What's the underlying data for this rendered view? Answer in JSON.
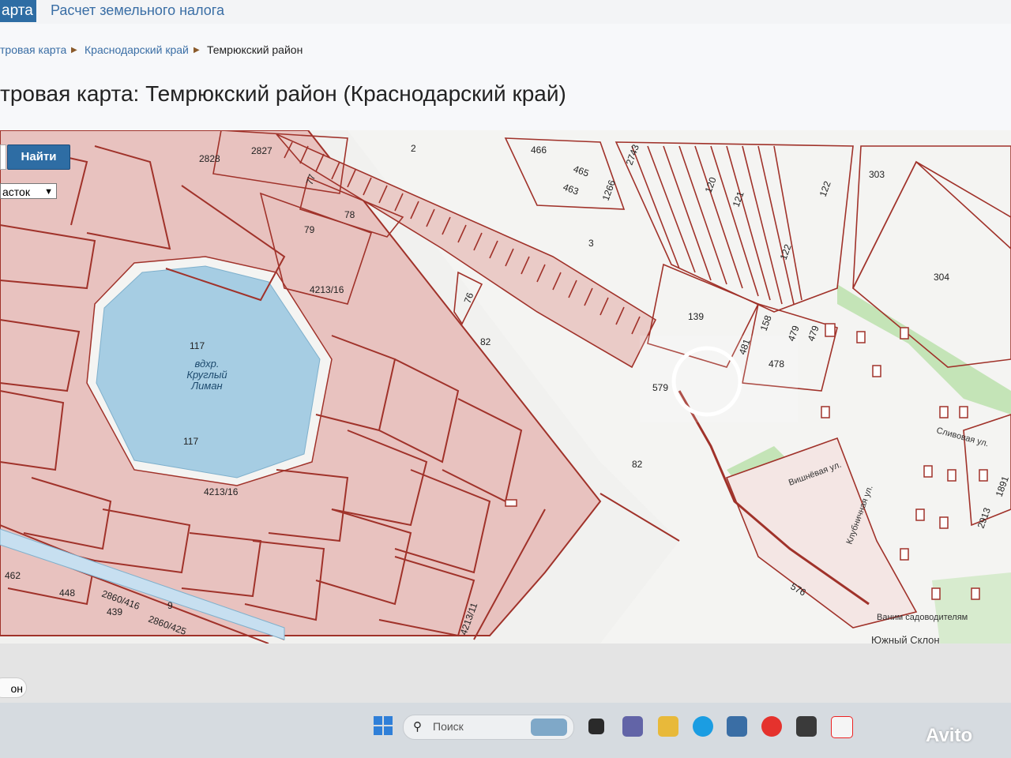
{
  "header": {
    "active_tab": "арта",
    "tax_tab": "Расчет земельного налога",
    "breadcrumb": [
      "тровая карта",
      "Краснодарский край",
      "Темрюкский район"
    ],
    "page_title": "тровая карта: Темрюкский район (Краснодарский край)"
  },
  "map_controls": {
    "search_button": "Найти",
    "object_type": "асток"
  },
  "map": {
    "lake_name": "вдхр. Круглый Лиман",
    "lake_lines": [
      "вдхр.",
      "Круглый",
      "Лиман"
    ],
    "parcel_labels": [
      "2828",
      "2827",
      "2",
      "466",
      "465",
      "463",
      "1266",
      "2743",
      "120",
      "121",
      "122",
      "303",
      "77",
      "78",
      "79",
      "3",
      "304",
      "4213/16",
      "76",
      "122",
      "139",
      "158",
      "479",
      "479",
      "117",
      "82",
      "481",
      "478",
      "579",
      "117",
      "82",
      "4213/16",
      "1891",
      "2913",
      "462",
      "448",
      "2860/416",
      "439",
      "9",
      "2860/425",
      "4213/11",
      "576"
    ],
    "street_labels": [
      "Сливовая ул.",
      "Вишнёвая ул.",
      "Клубничная ул.",
      "Южный Склон",
      "Ваним садоводителям"
    ]
  },
  "bottom": {
    "region_pill": "он"
  },
  "taskbar": {
    "search_placeholder": "Поиск"
  },
  "watermark": "Avito",
  "colors": {
    "parcel_stroke": "#a0322a",
    "pink_fill": "#e8c2bf",
    "lake_fill": "#a6cde3",
    "green": "#b8e0a8",
    "accent": "#2e6da4"
  }
}
